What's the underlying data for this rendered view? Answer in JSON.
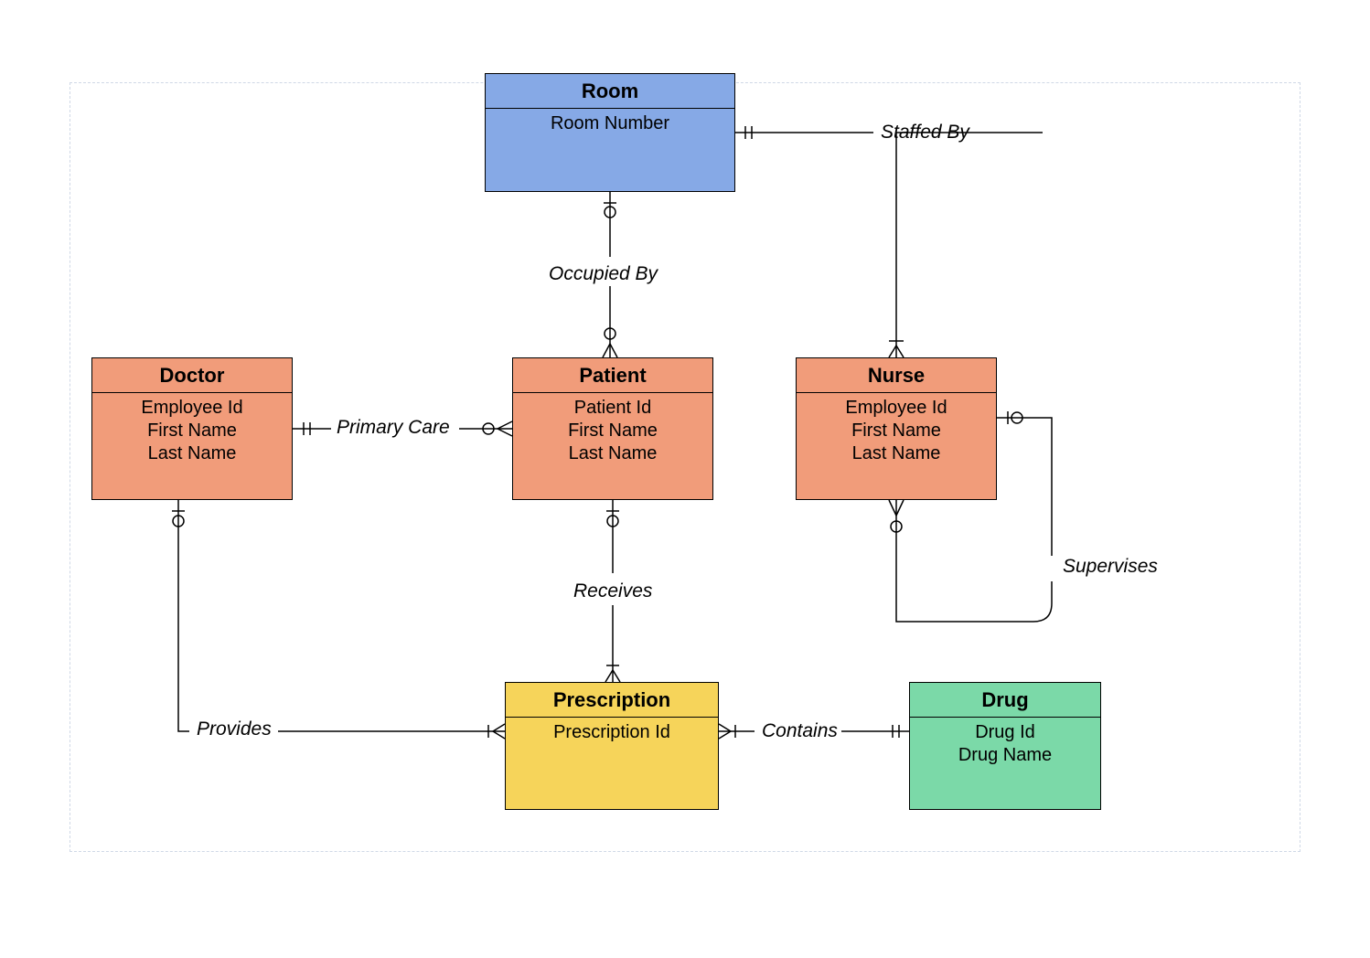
{
  "entities": {
    "room": {
      "title": "Room",
      "attrs": [
        "Room Number"
      ]
    },
    "doctor": {
      "title": "Doctor",
      "attrs": [
        "Employee Id",
        "First Name",
        "Last Name"
      ]
    },
    "patient": {
      "title": "Patient",
      "attrs": [
        "Patient Id",
        "First Name",
        "Last Name"
      ]
    },
    "nurse": {
      "title": "Nurse",
      "attrs": [
        "Employee Id",
        "First Name",
        "Last Name"
      ]
    },
    "prescription": {
      "title": "Prescription",
      "attrs": [
        "Prescription Id"
      ]
    },
    "drug": {
      "title": "Drug",
      "attrs": [
        "Drug Id",
        "Drug Name"
      ]
    }
  },
  "relationships": {
    "staffed_by": "Staffed By",
    "occupied_by": "Occupied By",
    "primary_care": "Primary Care",
    "receives": "Receives",
    "provides": "Provides",
    "contains": "Contains",
    "supervises": "Supervises"
  }
}
